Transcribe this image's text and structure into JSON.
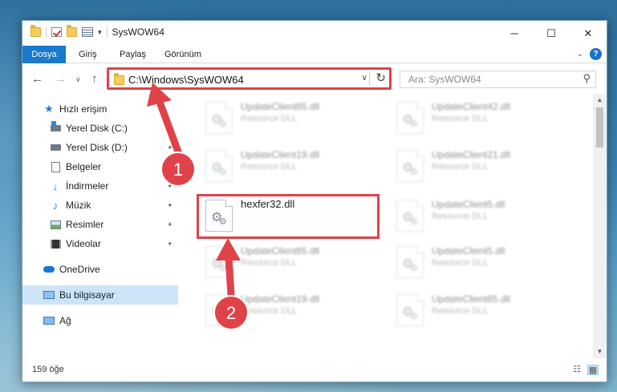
{
  "window": {
    "title": "SysWOW64",
    "minimize_glyph": "─",
    "maximize_glyph": "☐",
    "close_glyph": "✕"
  },
  "ribbon": {
    "tabs": [
      "Dosya",
      "Giriş",
      "Paylaş",
      "Görünüm"
    ],
    "expand_glyph": "⌄",
    "help_glyph": "?"
  },
  "navigation": {
    "back_glyph": "←",
    "forward_glyph": "→",
    "recent_glyph": "∨",
    "up_glyph": "↑",
    "address": "C:\\Windows\\SysWOW64",
    "address_dropdown_glyph": "∨",
    "refresh_glyph": "↻",
    "search_placeholder": "Ara: SysWOW64",
    "search_glyph": "⚲"
  },
  "sidebar": {
    "items": [
      {
        "label": "Hızlı erişim",
        "icon": "star-icon"
      },
      {
        "label": "Yerel Disk (C:)",
        "icon": "drive-c-icon",
        "pinned": true
      },
      {
        "label": "Yerel Disk (D:)",
        "icon": "drive-d-icon",
        "pinned": true
      },
      {
        "label": "Belgeler",
        "icon": "documents-icon",
        "pinned": true
      },
      {
        "label": "İndirmeler",
        "icon": "downloads-icon",
        "pinned": true
      },
      {
        "label": "Müzik",
        "icon": "music-icon",
        "pinned": true
      },
      {
        "label": "Resimler",
        "icon": "pictures-icon",
        "pinned": true
      },
      {
        "label": "Videolar",
        "icon": "videos-icon",
        "pinned": true
      },
      {
        "label": "OneDrive",
        "icon": "onedrive-icon"
      },
      {
        "label": "Bu bilgisayar",
        "icon": "this-pc-icon",
        "selected": true
      },
      {
        "label": "Ağ",
        "icon": "network-icon"
      }
    ],
    "pin_glyph": "📌"
  },
  "files": [
    {
      "name": "UpdateClient65.dll",
      "type": "Resource DLL"
    },
    {
      "name": "UpdateClient42.dll",
      "type": "Resource DLL"
    },
    {
      "name": "UpdateClient19.dll",
      "type": "Resource DLL"
    },
    {
      "name": "UpdateClient21.dll",
      "type": "Resource DLL"
    },
    {
      "name": "hexfer32.dll",
      "type": ""
    },
    {
      "name": "UpdateClient5.dll",
      "type": "Resource DLL"
    },
    {
      "name": "UpdateClient65.dll",
      "type": "Resource DLL"
    },
    {
      "name": "UpdateClient5.dll",
      "type": "Resource DLL"
    },
    {
      "name": "UpdateClient19.dll",
      "type": "Resource DLL"
    },
    {
      "name": "UpdateClient65.dll",
      "type": "Resource DLL"
    }
  ],
  "status": {
    "item_count": "159 öğe",
    "details_view_glyph": "☷",
    "icons_view_glyph": "▦"
  },
  "annotations": {
    "step_1": "1",
    "step_2": "2",
    "color": "#e0424a"
  }
}
